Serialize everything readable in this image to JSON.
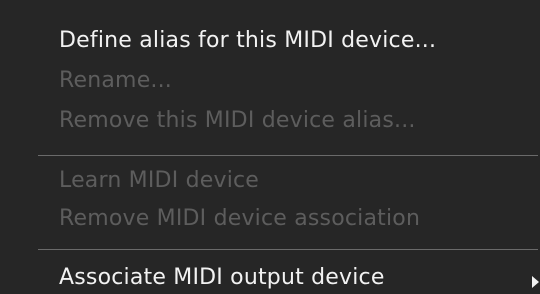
{
  "menu": {
    "items": [
      {
        "label": "Define alias for this MIDI device...",
        "enabled": true
      },
      {
        "label": "Rename...",
        "enabled": false
      },
      {
        "label": "Remove this MIDI device alias...",
        "enabled": false
      },
      {
        "label": "Learn MIDI device",
        "enabled": false
      },
      {
        "label": "Remove MIDI device association",
        "enabled": false
      },
      {
        "label": "Associate MIDI output device",
        "enabled": true,
        "submenu": true
      }
    ]
  },
  "colors": {
    "background": "#262626",
    "text_enabled": "#f2f2f2",
    "text_disabled": "#5d5d5d",
    "separator": "#6a6a6a"
  }
}
